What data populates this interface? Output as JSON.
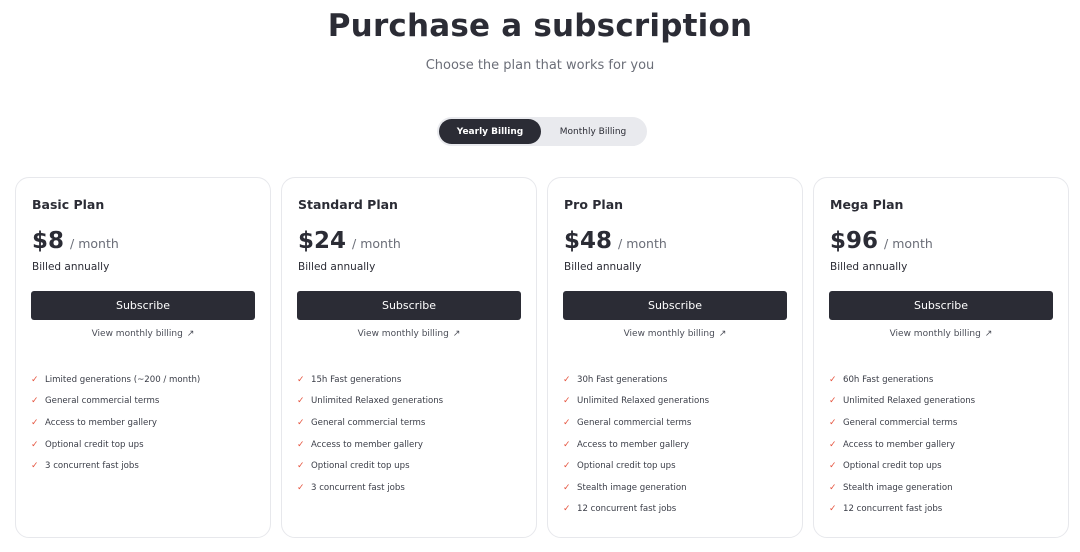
{
  "header": {
    "title": "Purchase a subscription",
    "subtitle": "Choose the plan that works for you"
  },
  "billing_toggle": {
    "options": [
      "Yearly Billing",
      "Monthly Billing"
    ],
    "selected": "Yearly Billing"
  },
  "accent_colors": {
    "dark": "#2b2c35",
    "check": "#e5533d"
  },
  "plans": [
    {
      "name": "Basic Plan",
      "price": "$8",
      "per": "/ month",
      "billed": "Billed annually",
      "subscribe_label": "Subscribe",
      "monthly_link": "View monthly billing",
      "features": [
        "Limited generations (~200 / month)",
        "General commercial terms",
        "Access to member gallery",
        "Optional credit top ups",
        "3 concurrent fast jobs"
      ]
    },
    {
      "name": "Standard Plan",
      "price": "$24",
      "per": "/ month",
      "billed": "Billed annually",
      "subscribe_label": "Subscribe",
      "monthly_link": "View monthly billing",
      "features": [
        "15h Fast generations",
        "Unlimited Relaxed generations",
        "General commercial terms",
        "Access to member gallery",
        "Optional credit top ups",
        "3 concurrent fast jobs"
      ]
    },
    {
      "name": "Pro Plan",
      "price": "$48",
      "per": "/ month",
      "billed": "Billed annually",
      "subscribe_label": "Subscribe",
      "monthly_link": "View monthly billing",
      "features": [
        "30h Fast generations",
        "Unlimited Relaxed generations",
        "General commercial terms",
        "Access to member gallery",
        "Optional credit top ups",
        "Stealth image generation",
        "12 concurrent fast jobs"
      ]
    },
    {
      "name": "Mega Plan",
      "price": "$96",
      "per": "/ month",
      "billed": "Billed annually",
      "subscribe_label": "Subscribe",
      "monthly_link": "View monthly billing",
      "features": [
        "60h Fast generations",
        "Unlimited Relaxed generations",
        "General commercial terms",
        "Access to member gallery",
        "Optional credit top ups",
        "Stealth image generation",
        "12 concurrent fast jobs"
      ]
    }
  ]
}
